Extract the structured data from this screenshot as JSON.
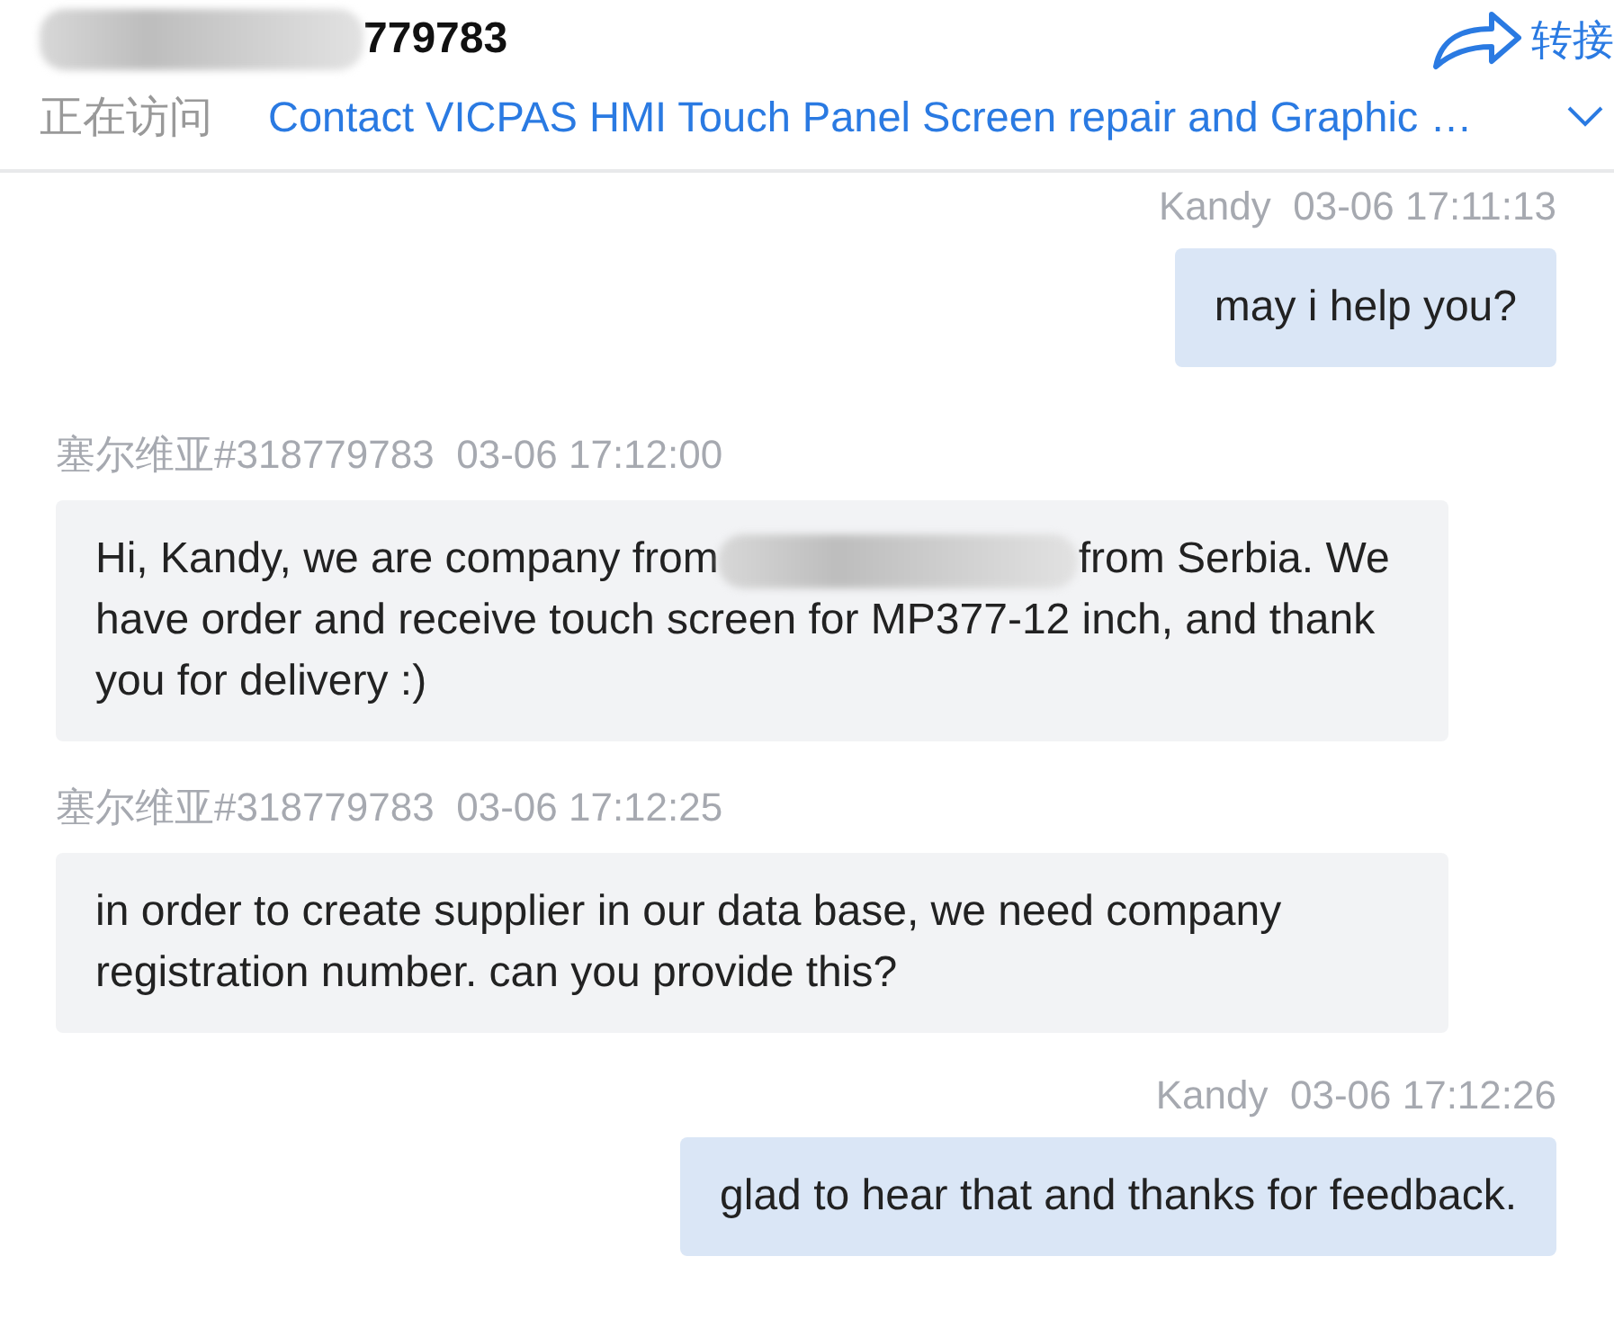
{
  "header": {
    "title": "779783",
    "title_redacted": true,
    "transfer_label": "转接",
    "visiting_label": "正在访问",
    "visiting_page": "Contact VICPAS HMI Touch Panel Screen repair and Graphic …"
  },
  "messages": [
    {
      "kind": "agent",
      "sender": "Kandy",
      "time": "03-06 17:11:13",
      "text_parts": [
        "may i help you?"
      ]
    },
    {
      "kind": "visitor",
      "sender": "塞尔维亚#318779783",
      "time": "03-06 17:12:00",
      "text_parts": [
        "Hi, Kandy, we are company from",
        "from Serbia. We have order and receive touch screen for MP377-12 inch, and thank you for delivery :)"
      ]
    },
    {
      "kind": "visitor",
      "sender": "塞尔维亚#318779783",
      "time": "03-06 17:12:25",
      "text_parts": [
        "in order to create supplier in our data base, we need company registration number. can you provide this?"
      ]
    },
    {
      "kind": "agent",
      "sender": "Kandy",
      "time": "03-06 17:12:26",
      "text_parts": [
        "glad to hear that and thanks for feedback."
      ]
    }
  ]
}
